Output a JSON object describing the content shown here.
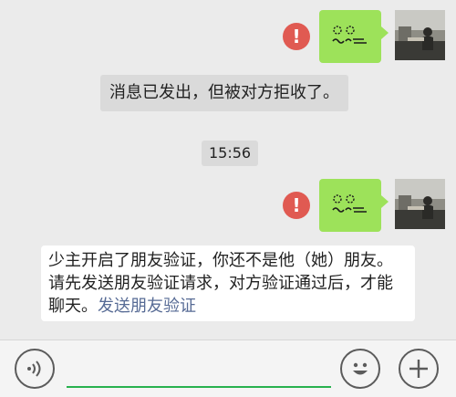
{
  "messages": {
    "system_rejected": "消息已发出，但被对方拒收了。",
    "time": "15:56",
    "friend_verify_text": "少主开启了朋友验证，你还不是他（她）朋友。请先发送朋友验证请求，对方验证通过后，才能聊天。",
    "friend_verify_link": "发送朋友验证",
    "error_mark": "!"
  },
  "colors": {
    "background": "#ebebeb",
    "my_bubble": "#9de25a",
    "error_icon": "#e05a52",
    "system_bubble": "#dadada",
    "link": "#576b95",
    "input_underline": "#27b14e"
  },
  "icons": {
    "voice": "voice-icon",
    "emoji": "emoji-icon",
    "add": "plus-icon",
    "error": "error-icon"
  }
}
